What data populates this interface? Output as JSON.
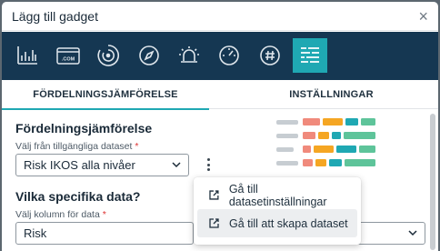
{
  "dialog": {
    "title": "Lägg till gadget",
    "close_label": "×"
  },
  "toolbar": {
    "icons": [
      "bar-chart-icon",
      "domain-com-icon",
      "refresh-circle-icon",
      "compass-icon",
      "alarm-bell-icon",
      "gauge-icon",
      "hashtag-icon",
      "distribution-lines-icon"
    ],
    "active_icon": "distribution-lines-icon",
    "domain_text": ".COM",
    "colors": {
      "background": "#153752",
      "active": "#1fa8b3"
    }
  },
  "tabs": [
    {
      "label": "FÖRDELNINGSJÄMFÖRELSE",
      "active": true
    },
    {
      "label": "INSTÄLLNINGAR",
      "active": false
    }
  ],
  "section1": {
    "heading": "Fördelningsjämförelse",
    "dataset_label": "Välj från tillgängliga dataset",
    "required_mark": "*",
    "dataset_value": "Risk IKOS alla nivåer"
  },
  "section2": {
    "heading": "Vilka specifika data?",
    "column_label": "Välj kolumn för data",
    "required_mark": "*",
    "column_value": "Risk"
  },
  "menu": {
    "items": [
      {
        "label": "Gå till datasetinställningar",
        "icon": "external-link-icon"
      },
      {
        "label": "Gå till att skapa dataset",
        "icon": "external-link-icon",
        "hover": true
      }
    ]
  },
  "preview_colors": [
    "#c7cdd2",
    "#f08a7c",
    "#f5a623",
    "#1fa8b3",
    "#5ec49a"
  ]
}
